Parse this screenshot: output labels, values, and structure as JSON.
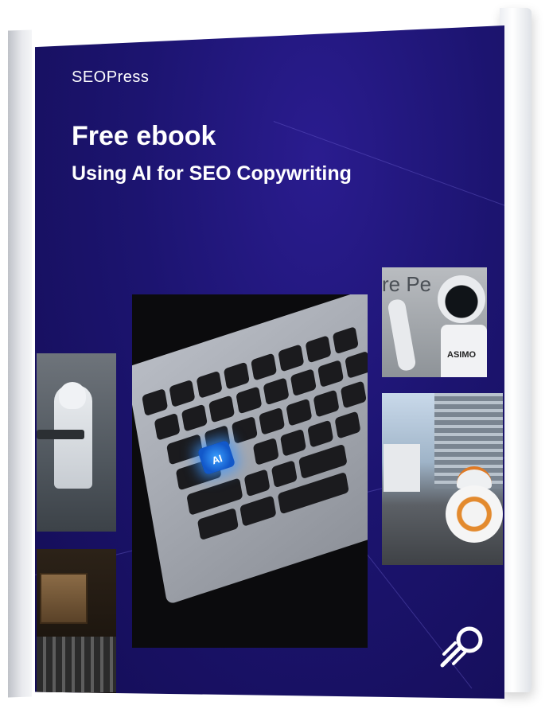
{
  "brand": {
    "name": "SEOPress"
  },
  "cover": {
    "title": "Free ebook",
    "subtitle": "Using AI for SEO Copywriting"
  },
  "photos": {
    "keyboard": {
      "key_label": "AI",
      "icon": "keyboard-photo"
    },
    "robot_asimo": {
      "wall_text": "re Pe",
      "label": "ASIMO"
    },
    "robot_stormtrooper": {
      "icon": "stormtrooper-photo"
    },
    "robot_bb8": {
      "icon": "bb8-photo"
    },
    "enigma": {
      "icon": "enigma-machine-photo"
    }
  },
  "colors": {
    "cover_background": "#1c1470",
    "accent_glow": "#3aa0ff",
    "text": "#ffffff"
  },
  "logo_icon": "seopress-rocket-icon"
}
